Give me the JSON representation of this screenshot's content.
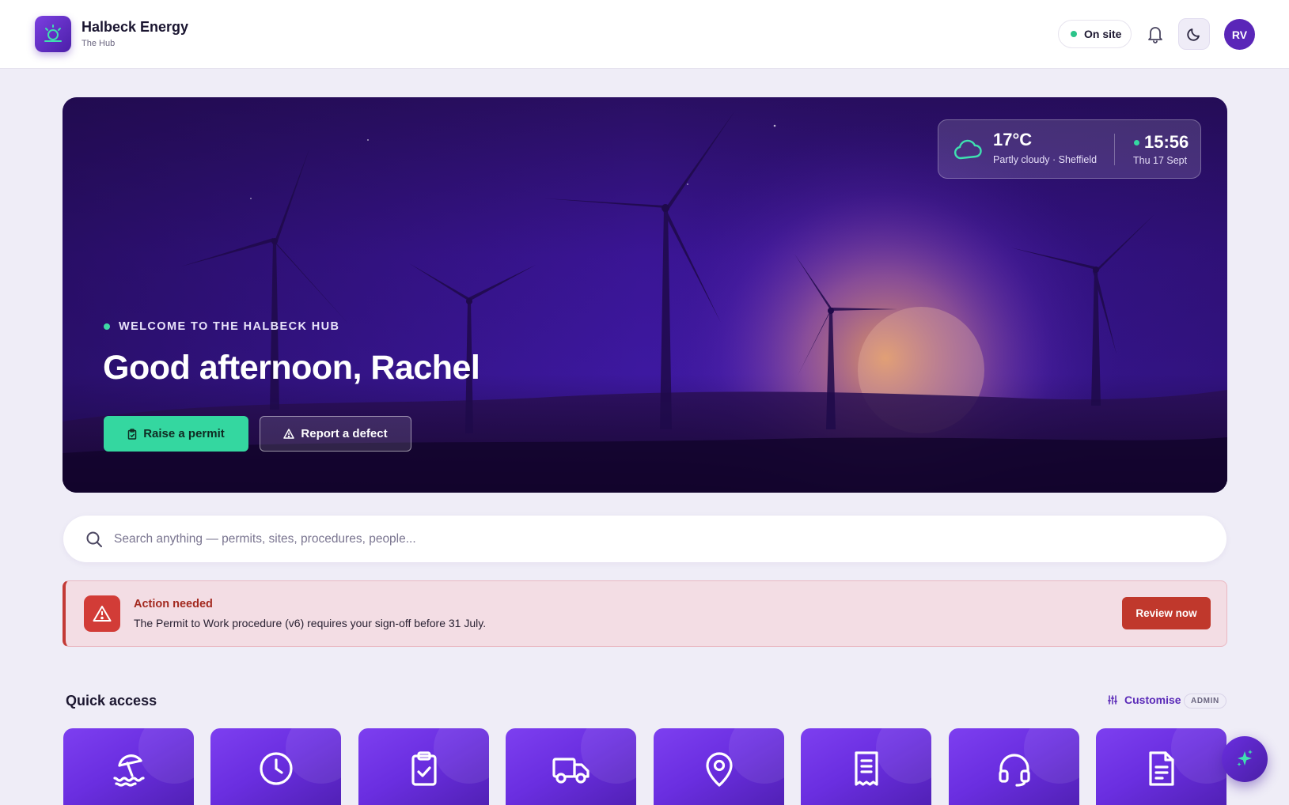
{
  "header": {
    "brand_name": "Halbeck Energy",
    "brand_sub": "The Hub",
    "status_label": "On site",
    "avatar_initials": "RV"
  },
  "hero": {
    "kicker": "WELCOME TO THE HALBECK HUB",
    "greeting": "Good afternoon, Rachel",
    "primary_button": "Raise a permit",
    "secondary_button": "Report a defect",
    "weather": {
      "temperature": "17°C",
      "description": "Partly cloudy · Sheffield",
      "time": "15:56",
      "date": "Thu 17 Sept"
    }
  },
  "search": {
    "placeholder": "Search anything — permits, sites, procedures, people..."
  },
  "alert": {
    "title": "Action needed",
    "message": "The Permit to Work procedure (v6) requires your sign-off before 31 July.",
    "button": "Review now"
  },
  "quick_access": {
    "title": "Quick access",
    "customise_label": "Customise",
    "admin_badge": "ADMIN",
    "tiles": [
      {
        "icon": "beach-umbrella-icon"
      },
      {
        "icon": "clock-icon"
      },
      {
        "icon": "clipboard-check-icon"
      },
      {
        "icon": "truck-icon"
      },
      {
        "icon": "map-pin-icon"
      },
      {
        "icon": "receipt-icon"
      },
      {
        "icon": "headset-icon"
      },
      {
        "icon": "document-icon"
      }
    ]
  },
  "colors": {
    "accent": "#5b2bb8",
    "primary_button": "#34d7a0",
    "alert": "#c0382c"
  }
}
